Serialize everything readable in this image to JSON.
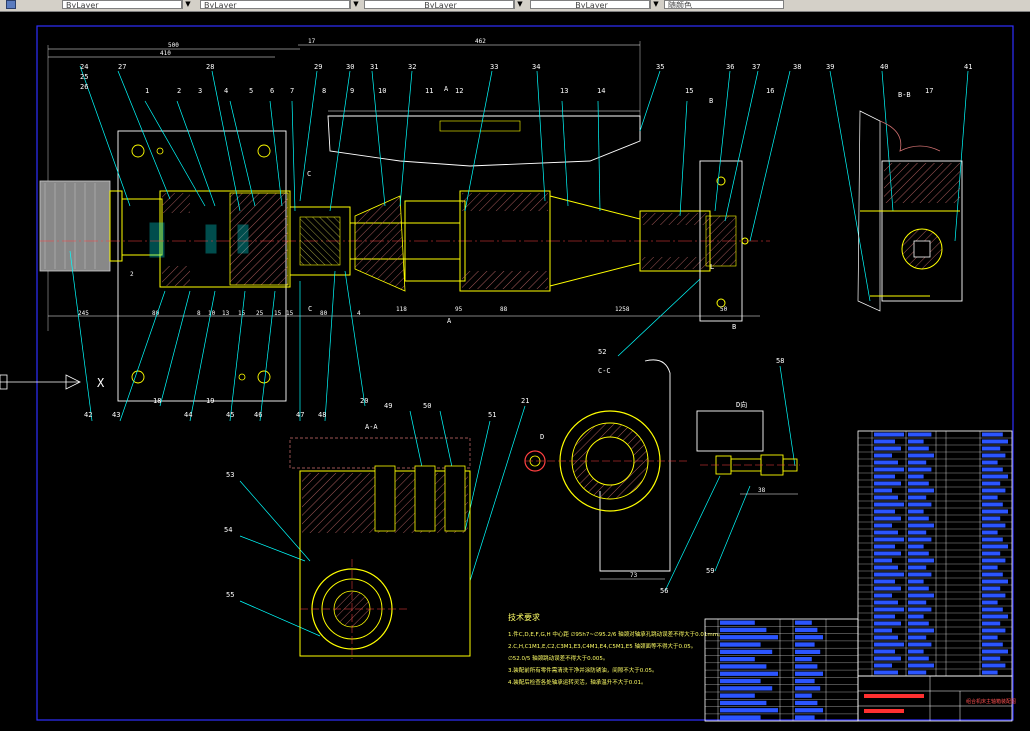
{
  "toolbar": {
    "layer_value": "ByLayer",
    "linetype_value": "ByLayer",
    "lineweight_value": "ByLayer",
    "color_value": "随颜色"
  },
  "view_labels": {
    "section_bb": "B-B",
    "section_cc": "C-C",
    "section_aa": "A-A",
    "view_d": "D向",
    "axis_x": "X",
    "marker_a": "A",
    "marker_b": "B",
    "marker_c": "C",
    "marker_d": "D",
    "marker_l": "L"
  },
  "top_dims": [
    "500",
    "410",
    "17",
    "462"
  ],
  "bottom_dims": [
    "245",
    "2",
    "80",
    "8",
    "10",
    "13",
    "15",
    "25",
    "15",
    "15",
    "80",
    "4",
    "118",
    "95",
    "88",
    "1258",
    "50"
  ],
  "dim_73": "73",
  "dim_38": "38",
  "callouts_top": [
    "24",
    "25",
    "26",
    "27",
    "1",
    "2",
    "28",
    "3",
    "4",
    "5",
    "6",
    "7",
    "8",
    "29",
    "9",
    "30",
    "31",
    "10",
    "32",
    "11",
    "12",
    "33",
    "34",
    "13",
    "14",
    "35",
    "15",
    "36",
    "37",
    "16",
    "38",
    "39",
    "40",
    "17",
    "41"
  ],
  "callouts_bottom": [
    "42",
    "43",
    "18",
    "44",
    "19",
    "45",
    "46",
    "47",
    "48",
    "20",
    "49",
    "50",
    "51",
    "21",
    "52",
    "53",
    "54",
    "55",
    "56",
    "58",
    "59"
  ],
  "tech_req": {
    "title": "技术要求",
    "lines": [
      "1.件C,D,E,F,G,H 中心距 ∅95h7~∅95.2/6 轴颈对轴承孔跳动误差不得大于0.01mm。",
      "2.C,H,C1M1,E,C2,C3M1,E3,C4M1,E4,C5M1,E5 轴颈面等不得大于0.05。",
      "∅52.0/5 轴颈跳动误差不得大于0.005。",
      "3.装配前所有零件需清洗干净并涂防锈油，间隙不大于0.05。",
      "4.装配后检查各处轴承运转灵活，轴承温升不大于0.01。"
    ]
  },
  "title_block": {
    "drawing_title": "组合机床主轴箱装配图"
  }
}
